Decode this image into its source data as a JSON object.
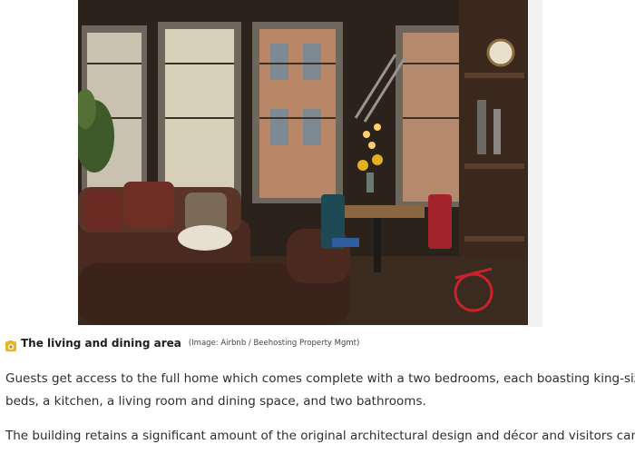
{
  "caption": {
    "title": "The living and dining area",
    "credit": "(Image: Airbnb / Beehosting Property Mgmt)"
  },
  "body": {
    "paragraph_1_line_1": "Guests get access to the full home which comes complete with a two bedrooms, each boasting king-sized",
    "paragraph_1_line_2": "beds, a kitchen, a living room and dining space, and two bathrooms.",
    "paragraph_2_line_1": "The building retains a significant amount of the original architectural design and décor and visitors can"
  },
  "colors": {
    "icon_accent": "#e8b62c",
    "photo_dark": "#2a211b",
    "text": "#2e2e2e"
  },
  "icons": [
    "camera-icon"
  ]
}
